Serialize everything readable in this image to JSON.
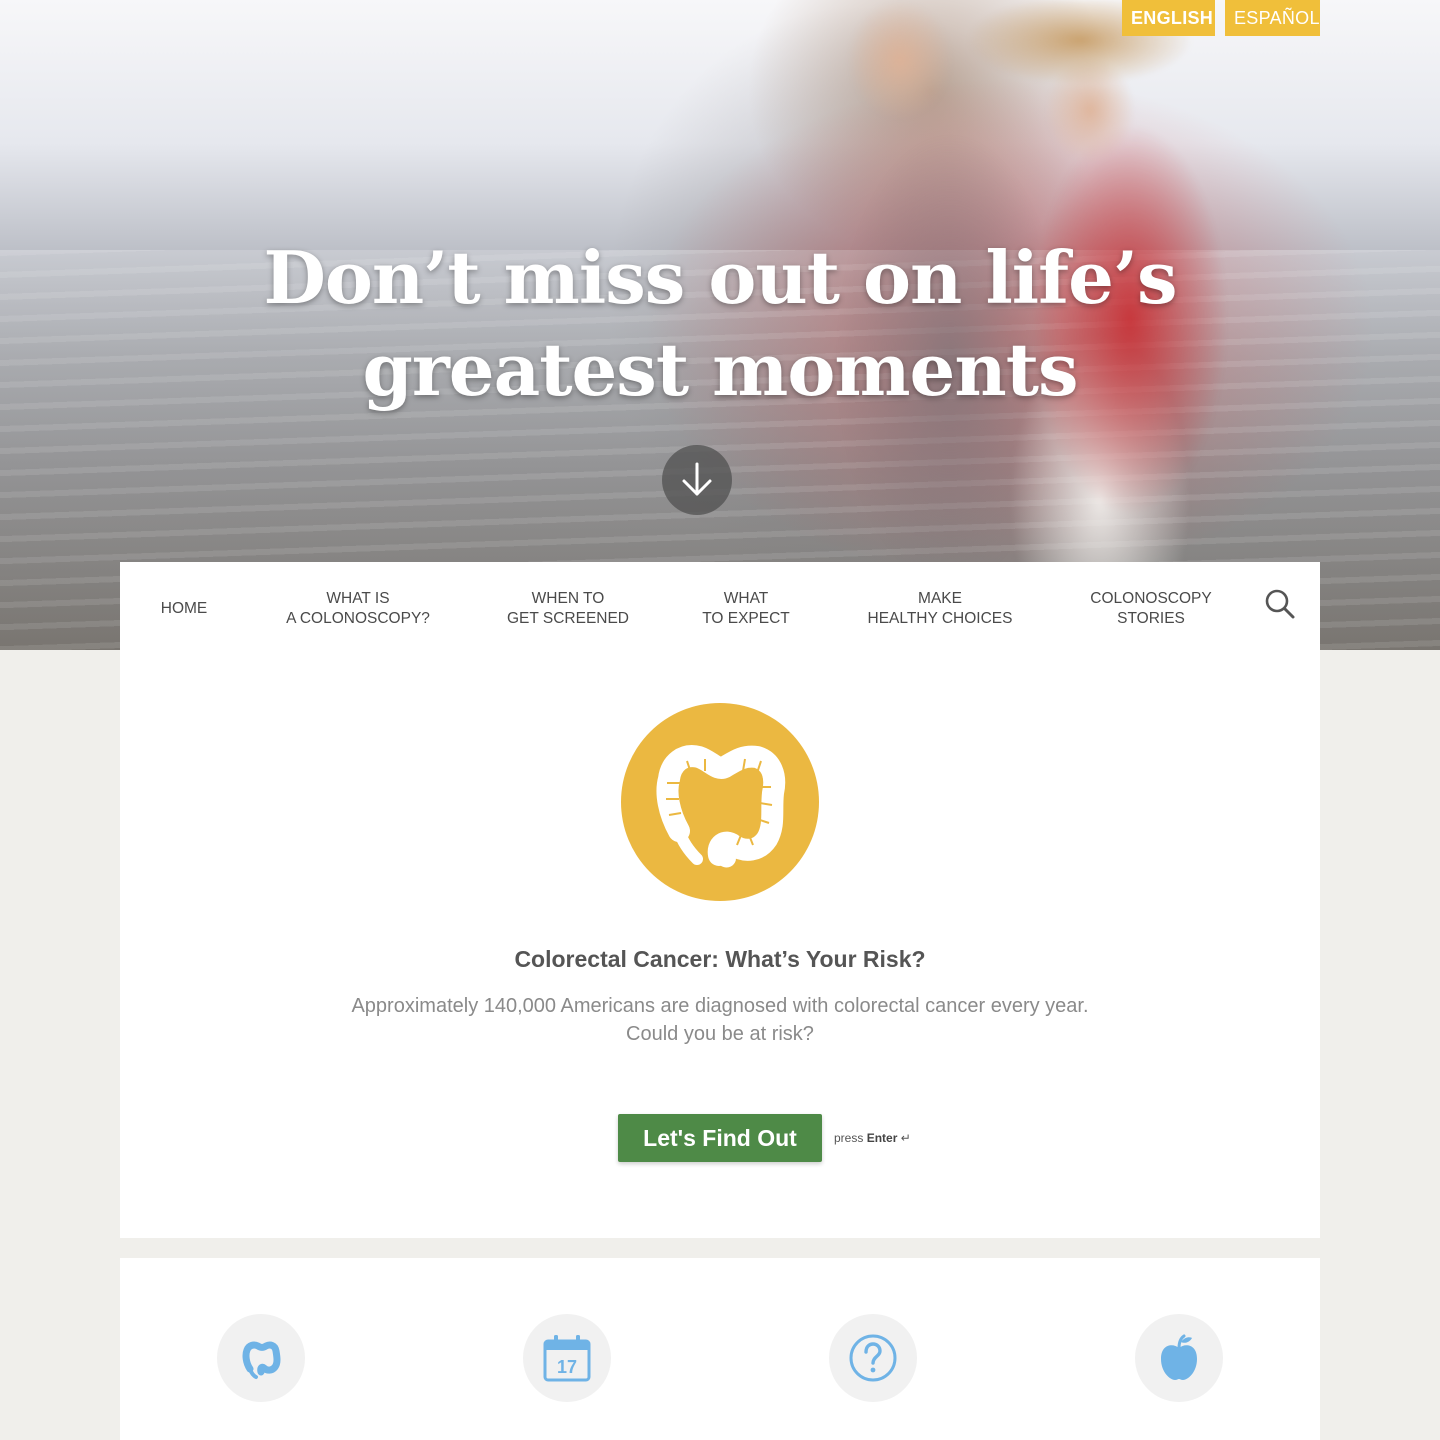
{
  "language": {
    "english": "ENGLISH",
    "spanish": "ESPAÑOL"
  },
  "hero": {
    "title_line1": "Don’t miss out on life’s",
    "title_line2": "greatest moments"
  },
  "nav": {
    "home": "HOME",
    "colonoscopy_line1": "WHAT IS",
    "colonoscopy_line2": "A COLONOSCOPY?",
    "screened_line1": "WHEN TO",
    "screened_line2": "GET SCREENED",
    "expect_line1": "WHAT",
    "expect_line2": "TO EXPECT",
    "healthy_line1": "MAKE",
    "healthy_line2": "HEALTHY CHOICES",
    "stories_line1": "COLONOSCOPY",
    "stories_line2": "STORIES"
  },
  "risk": {
    "title": "Colorectal Cancer: What’s Your Risk?",
    "desc_line1": "Approximately 140,000 Americans are diagnosed with colorectal cancer every year.",
    "desc_line2": "Could you be at risk?",
    "button": "Let's Find Out",
    "hint_press": "press",
    "hint_key": "Enter",
    "hint_symbol": "↵"
  },
  "features": {
    "calendar_day": "17"
  },
  "colors": {
    "accent_yellow": "#ebb841",
    "lang_yellow": "#f0bf3a",
    "cta_green": "#4e8a47",
    "icon_blue": "#6fb3e6"
  }
}
